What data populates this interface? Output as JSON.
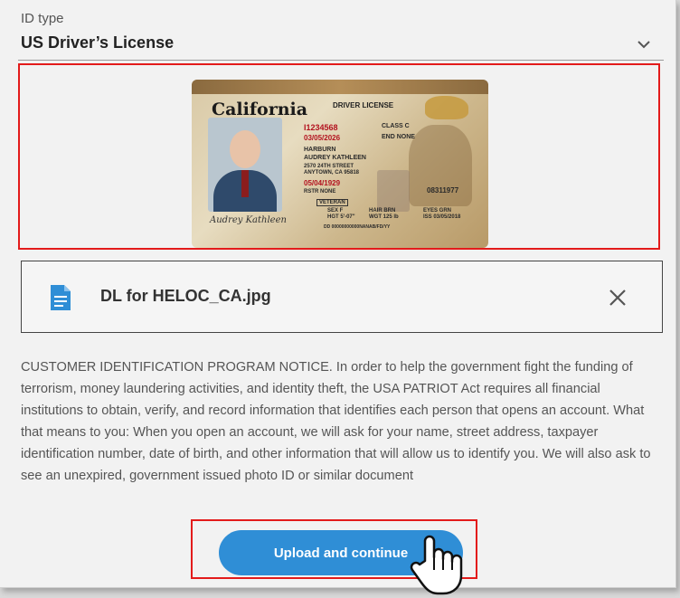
{
  "id_type": {
    "label": "ID type",
    "value": "US Driver’s License"
  },
  "license_image": {
    "state": "California",
    "type": "DRIVER LICENSE",
    "dl_number": "I1234568",
    "exp": "03/05/2026",
    "last_name": "HARBURN",
    "first_name": "AUDREY KATHLEEN",
    "address": "2570 24TH STREET",
    "city": "ANYTOWN, CA 95818",
    "dob": "05/04/1929",
    "restr": "RSTR NONE",
    "class": "CLASS C",
    "end": "END NONE",
    "veteran": "VETERAN",
    "sex": "SEX F",
    "hair": "HAIR BRN",
    "eyes": "EYES GRN",
    "hgt": "HGT 5'-07\"",
    "wgt": "WGT 125 lb",
    "iss": "ISS 03/05/2018",
    "dd": "DD 00000000000NANAB/FD/YY",
    "doc_number": "08311977",
    "signature": "Audrey Kathleen"
  },
  "file": {
    "name": "DL for HELOC_CA.jpg",
    "icon": "document-icon"
  },
  "notice": "CUSTOMER IDENTIFICATION PROGRAM NOTICE. In order to help the government fight the funding of terrorism, money laundering activities, and identity theft, the USA PATRIOT Act requires all financial institutions to obtain, verify, and record information that identifies each person that opens an account. What that means to you: When you open an account, we will ask for your name, street address, taxpayer identification number, date of birth, and other information that will allow us to identify you. We will also ask to see an unexpired, government issued photo ID or similar document",
  "upload_button": "Upload and continue",
  "colors": {
    "accent": "#2f8ed6",
    "highlight": "#e31b1b"
  }
}
